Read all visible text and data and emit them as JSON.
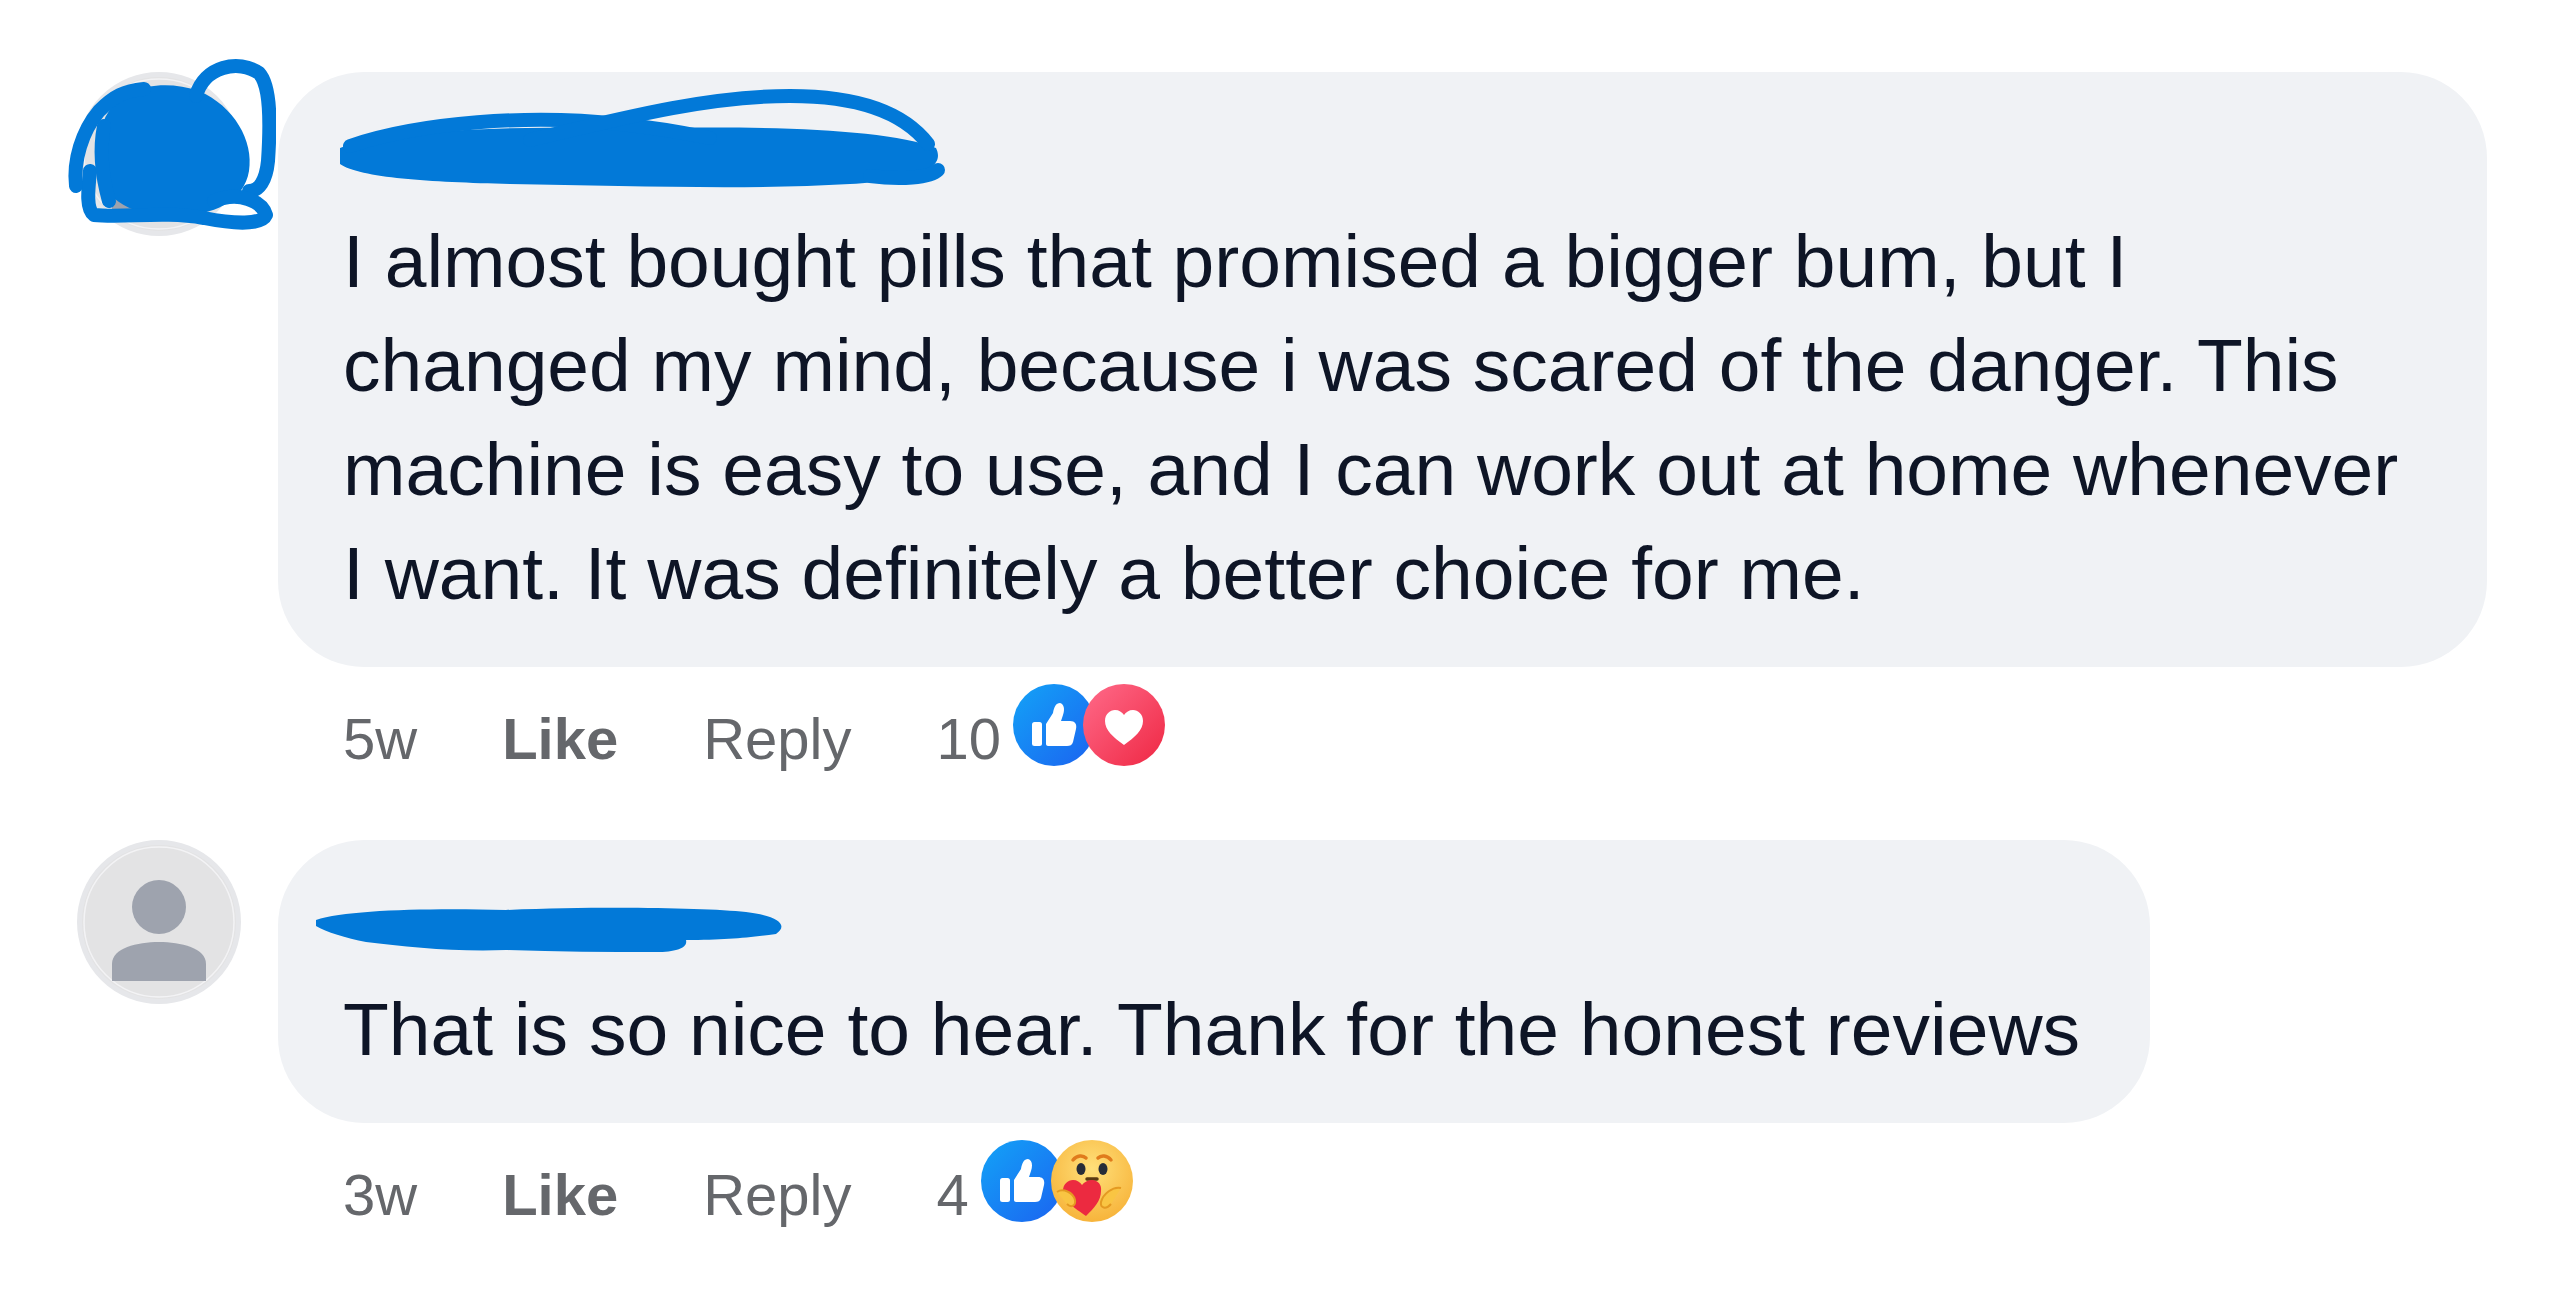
{
  "comments": [
    {
      "author": {
        "name_redacted": true,
        "avatar_redacted": true
      },
      "text": "I almost bought pills that promised a bigger bum, but I changed my mind, because i was scared of the danger. This machine is easy to use, and I can work out at home whenever I want. It was definitely a better choice for me.",
      "time": "5w",
      "actions": [
        {
          "kind": "like",
          "label": "Like"
        },
        {
          "kind": "reply",
          "label": "Reply"
        }
      ],
      "reactions": {
        "count": "10",
        "icons": [
          {
            "kind": "like"
          },
          {
            "kind": "love"
          }
        ]
      }
    },
    {
      "author": {
        "name_redacted": true,
        "avatar_redacted": false
      },
      "text": "That is so nice to hear. Thank for the honest reviews",
      "time": "3w",
      "actions": [
        {
          "kind": "like",
          "label": "Like"
        },
        {
          "kind": "reply",
          "label": "Reply"
        }
      ],
      "reactions": {
        "count": "4",
        "icons": [
          {
            "kind": "like"
          },
          {
            "kind": "care"
          }
        ]
      }
    }
  ]
}
